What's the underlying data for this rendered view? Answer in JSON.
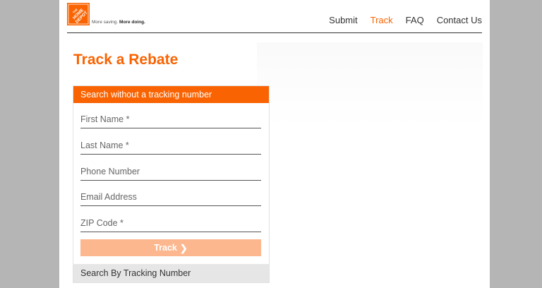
{
  "brand": {
    "logo_text": "THE HOME DEPOT",
    "tagline_regular": "More saving.",
    "tagline_bold": "More doing.",
    "color": "#f96302"
  },
  "nav": {
    "items": [
      {
        "label": "Submit",
        "active": false
      },
      {
        "label": "Track",
        "active": true
      },
      {
        "label": "FAQ",
        "active": false
      },
      {
        "label": "Contact Us",
        "active": false
      }
    ]
  },
  "page": {
    "title": "Track a Rebate"
  },
  "form": {
    "header": "Search without a tracking number",
    "fields": {
      "first_name": {
        "placeholder": "First Name *",
        "value": ""
      },
      "last_name": {
        "placeholder": "Last Name *",
        "value": ""
      },
      "phone": {
        "placeholder": "Phone Number",
        "value": ""
      },
      "email": {
        "placeholder": "Email Address",
        "value": ""
      },
      "zip": {
        "placeholder": "ZIP Code *",
        "value": ""
      }
    },
    "submit_label": "Track",
    "submit_icon": "chevron-right-icon",
    "alt_tab_label": "Search By Tracking Number"
  }
}
